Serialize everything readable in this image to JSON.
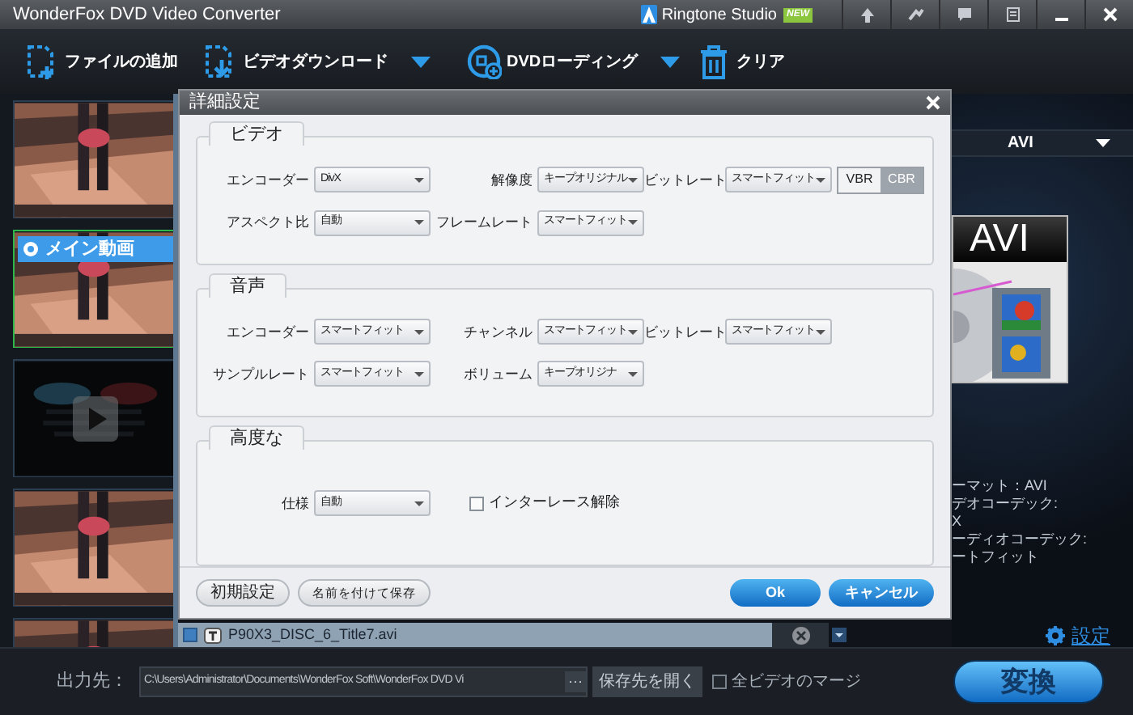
{
  "window": {
    "title": "WonderFox DVD Video Converter",
    "ringtone_studio": "Ringtone Studio",
    "badge": "NEW"
  },
  "toolbar": [
    {
      "label": "ファイルの追加",
      "dropdown": false
    },
    {
      "label": "ビデオダウンロード",
      "dropdown": true
    },
    {
      "label": "DVDローディング",
      "dropdown": true
    },
    {
      "label": "クリア",
      "dropdown": false
    }
  ],
  "thumbnails": [
    {
      "kind": "picture",
      "selected": false
    },
    {
      "kind": "picture",
      "selected": true,
      "tag": "メイン動画"
    },
    {
      "kind": "dark",
      "selected": false
    },
    {
      "kind": "picture",
      "selected": false
    },
    {
      "kind": "picture",
      "selected": false
    }
  ],
  "file_row": {
    "name": "P90X3_DISC_6_Title7.avi",
    "checked": true
  },
  "format_panel": {
    "format": "AVI",
    "icon_label": "AVI",
    "info": [
      "ーマット：AVI",
      "デオコーデック:",
      "X",
      "ーディオコーデック:",
      "ートフィット"
    ],
    "settings_link": "設定"
  },
  "dialog": {
    "title": "詳細設定",
    "sections": [
      {
        "title": "ビデオ",
        "rows": [
          [
            {
              "kind": "select",
              "label": "エンコーダー",
              "value": "DivX"
            },
            {
              "kind": "select",
              "label": "解像度",
              "value": "キープオリジナル"
            },
            {
              "kind": "select",
              "label": "ビットレート",
              "value": "スマートフィット"
            },
            {
              "kind": "toggle",
              "options": [
                {
                  "label": "VBR",
                  "selected": false
                },
                {
                  "label": "CBR",
                  "selected": true
                }
              ]
            }
          ],
          [
            {
              "kind": "select",
              "label": "アスペクト比",
              "value": "自動"
            },
            {
              "kind": "select",
              "label": "フレームレート",
              "value": "スマートフィット"
            }
          ]
        ]
      },
      {
        "title": "音声",
        "rows": [
          [
            {
              "kind": "select",
              "label": "エンコーダー",
              "value": "スマートフィット"
            },
            {
              "kind": "select",
              "label": "チャンネル",
              "value": "スマートフィット"
            },
            {
              "kind": "select",
              "label": "ビットレート",
              "value": "スマートフィット"
            }
          ],
          [
            {
              "kind": "select",
              "label": "サンプルレート",
              "value": "スマートフィット"
            },
            {
              "kind": "select",
              "label": "ボリューム",
              "value": "キープオリジナ"
            }
          ]
        ]
      },
      {
        "title": "高度な",
        "rows": [
          [
            {
              "kind": "select",
              "label": "仕様",
              "value": "自動"
            },
            {
              "kind": "checkbox",
              "label": "インターレース解除",
              "checked": false
            }
          ]
        ]
      }
    ],
    "buttons": [
      {
        "label": "初期設定",
        "kind": "plain"
      },
      {
        "label": "名前を付けて保存",
        "kind": "plain"
      },
      {
        "label": "Ok",
        "kind": "primary"
      },
      {
        "label": "キャンセル",
        "kind": "primary"
      }
    ]
  },
  "bottom_bar": {
    "output_label": "出力先：",
    "path": "C:\\Users\\Administrator\\Documents\\WonderFox Soft\\WonderFox DVD Vi",
    "more": "···",
    "open_button": "保存先を開く",
    "merge": {
      "label": "全ビデオのマージ",
      "checked": false
    },
    "convert": "変換"
  }
}
